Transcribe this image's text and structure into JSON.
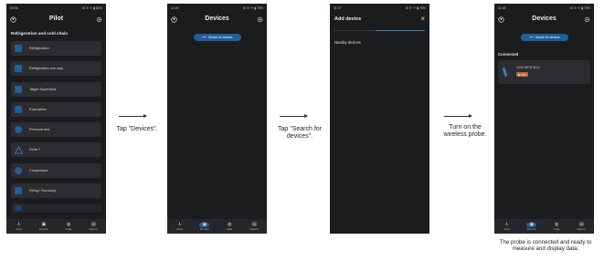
{
  "screen1": {
    "status_time": "09:06",
    "status_icons": "⚙ ✆ ᯤ ▮ 86%",
    "title": "Pilot",
    "section": "Refrigeration and cold chain",
    "items": [
      {
        "label": "Refrigeration",
        "color": "#1f5f9a",
        "glyph": "✻"
      },
      {
        "label": "Refrigeration one-way",
        "color": "#1f5f9a",
        "glyph": "✻"
      },
      {
        "label": "Target Superheat",
        "color": "#1f5f9a",
        "glyph": "◣"
      },
      {
        "label": "Evacuation",
        "color": "#1f5f9a",
        "glyph": "≡"
      },
      {
        "label": "Pressure test",
        "color": "#1f5f9a",
        "glyph": "◉"
      },
      {
        "label": "Delta T",
        "color": "#1f5f9a",
        "glyph": "△"
      },
      {
        "label": "Compressor",
        "color": "#1f5f9a",
        "glyph": "◌"
      },
      {
        "label": "Filling / Recovery",
        "color": "#1f5f9a",
        "glyph": "⬒"
      }
    ]
  },
  "screen2": {
    "status_time": "11:40",
    "status_icons": "⚙ ✆ ᯤ ▮ 75%",
    "title": "Devices",
    "search_label": "Search for devices"
  },
  "screen3": {
    "status_time": "11:37",
    "status_icons": "⚙ ✆ ᯤ ▮ 73%",
    "title": "Add device",
    "close": "×",
    "nearby": "Nearby devices"
  },
  "screen4": {
    "status_time": "11:45",
    "status_icons": "⚙ ✆ ᯤ ▮ 75%",
    "title": "Devices",
    "search_label": "Search for devices",
    "connected": "Connected",
    "device_id": "1234 5678 9012",
    "device_badge": "75%"
  },
  "nav": {
    "home": "Home",
    "devices": "Devices",
    "data": "Data",
    "reports": "Reports"
  },
  "captions": {
    "step1": "Tap \"Devices\".",
    "step2": "Tap \"Search for devices\".",
    "step3": "Turn on the wireless probe.",
    "final": "The probe is connected and ready to measure and display data."
  }
}
